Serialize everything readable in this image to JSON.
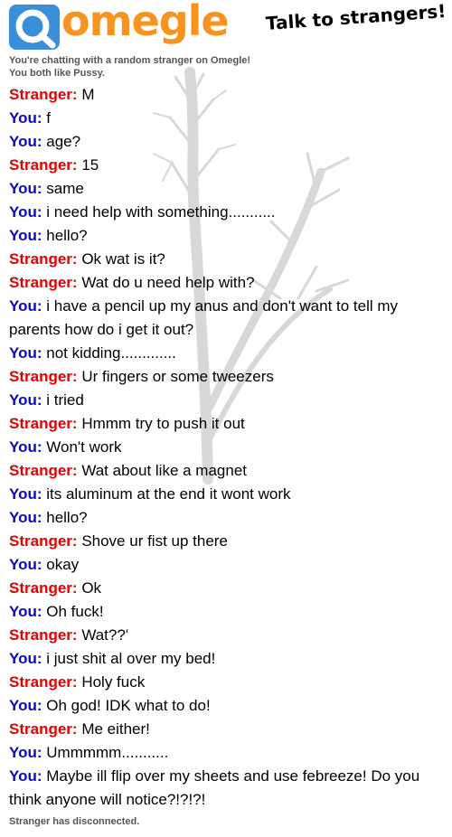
{
  "header": {
    "logo_text": "omegle",
    "tagline": "Talk to strangers!"
  },
  "status": {
    "connected": "You're chatting with a random stranger on Omegle!",
    "interests": "You both like Pussy.",
    "disconnected": "Stranger has disconnected."
  },
  "labels": {
    "stranger": "Stranger:",
    "you": "You:"
  },
  "messages": [
    {
      "who": "stranger",
      "text": "M"
    },
    {
      "who": "you",
      "text": "f"
    },
    {
      "who": "you",
      "text": "age?"
    },
    {
      "who": "stranger",
      "text": "15"
    },
    {
      "who": "you",
      "text": "same"
    },
    {
      "who": "you",
      "text": "i need help with something..........."
    },
    {
      "who": "you",
      "text": "hello?"
    },
    {
      "who": "stranger",
      "text": "Ok wat is it?"
    },
    {
      "who": "stranger",
      "text": "Wat do u need help with?"
    },
    {
      "who": "you",
      "text": "i have a pencil up my anus and don't want to tell my parents how do i get it out?"
    },
    {
      "who": "you",
      "text": "not kidding............."
    },
    {
      "who": "stranger",
      "text": "Ur fingers or some tweezers"
    },
    {
      "who": "you",
      "text": "i tried"
    },
    {
      "who": "stranger",
      "text": "Hmmm try to push it out"
    },
    {
      "who": "you",
      "text": "Won't work"
    },
    {
      "who": "stranger",
      "text": "Wat about like a magnet"
    },
    {
      "who": "you",
      "text": "its aluminum at the end it wont work"
    },
    {
      "who": "you",
      "text": "hello?"
    },
    {
      "who": "stranger",
      "text": "Shove ur fist up there"
    },
    {
      "who": "you",
      "text": "okay"
    },
    {
      "who": "stranger",
      "text": "Ok"
    },
    {
      "who": "you",
      "text": "Oh fuck!"
    },
    {
      "who": "stranger",
      "text": "Wat??'"
    },
    {
      "who": "you",
      "text": "i just shit al over my bed!"
    },
    {
      "who": "stranger",
      "text": "Holy fuck"
    },
    {
      "who": "you",
      "text": "Oh god! IDK what to do!"
    },
    {
      "who": "stranger",
      "text": "Me either!"
    },
    {
      "who": "you",
      "text": "Ummmmm..........."
    },
    {
      "who": "you",
      "text": "Maybe ill flip over my sheets and use febreeze! Do you think anyone will notice?!?!?!"
    }
  ],
  "colors": {
    "brand_orange": "#f7931e",
    "logo_blue": "#3a8fd9",
    "stranger_red": "#e30000",
    "you_blue": "#0b0bb5"
  },
  "icons": {
    "logo": "omegle-logo-icon"
  }
}
